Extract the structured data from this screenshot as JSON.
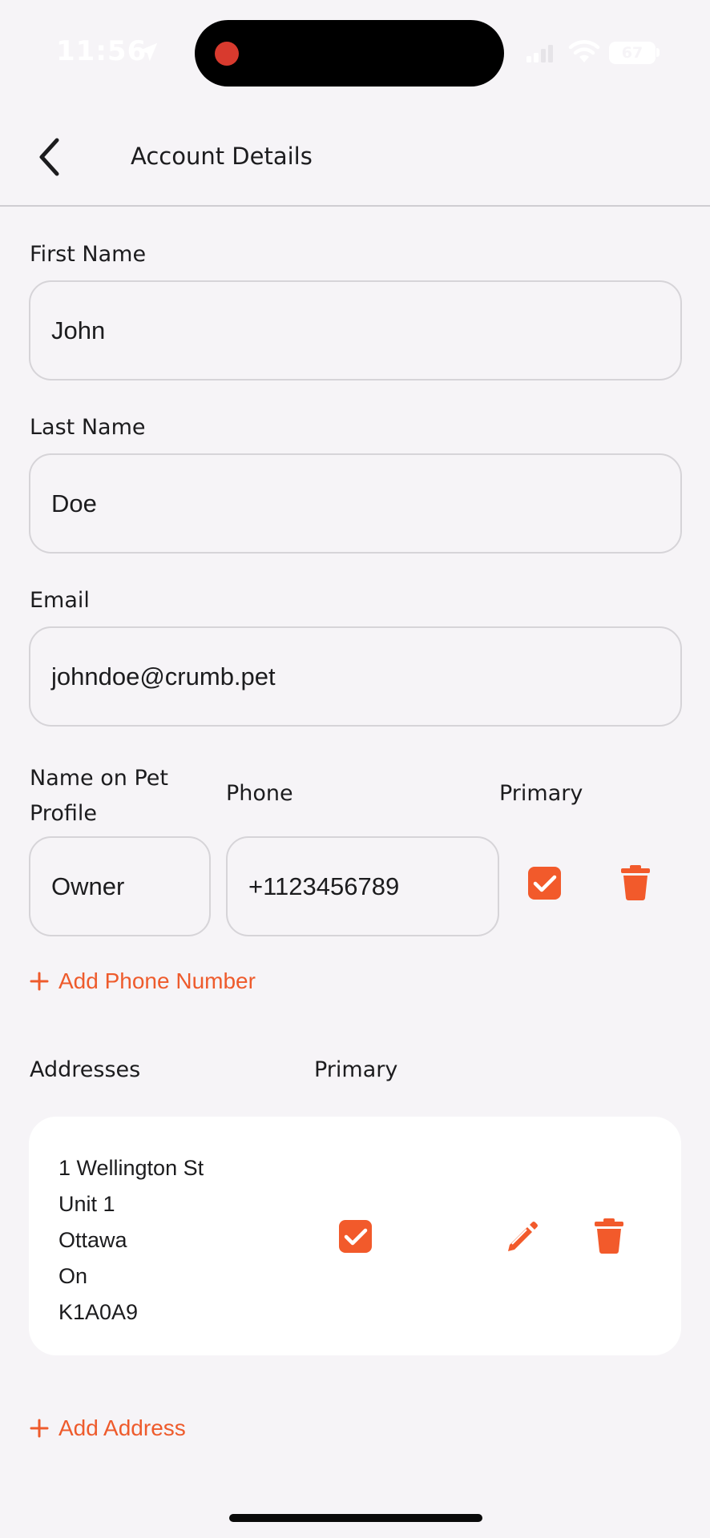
{
  "status_bar": {
    "time": "11:56",
    "battery": "67"
  },
  "header": {
    "title": "Account Details"
  },
  "form": {
    "first_name": {
      "label": "First Name",
      "value": "John"
    },
    "last_name": {
      "label": "Last Name",
      "value": "Doe"
    },
    "email": {
      "label": "Email",
      "value": "johndoe@crumb.pet"
    }
  },
  "phones": {
    "name_label": "Name on Pet Profile",
    "phone_label": "Phone",
    "primary_label": "Primary",
    "items": [
      {
        "name": "Owner",
        "phone": "+1123456789",
        "primary": true
      }
    ],
    "add_label": "Add Phone Number"
  },
  "addresses": {
    "label": "Addresses",
    "primary_label": "Primary",
    "items": [
      {
        "lines": [
          "1 Wellington St",
          "Unit 1",
          "Ottawa",
          "On",
          "K1A0A9"
        ],
        "primary": true
      }
    ],
    "add_label": "Add Address"
  },
  "colors": {
    "accent": "#f25a2b",
    "background": "#f6f4f7",
    "card": "#ffffff"
  },
  "icons": [
    "location-arrow-icon",
    "signal-icon",
    "wifi-icon",
    "battery-icon",
    "back-chevron-icon",
    "checkbox-checked-icon",
    "trash-icon",
    "pencil-icon",
    "plus-icon"
  ]
}
